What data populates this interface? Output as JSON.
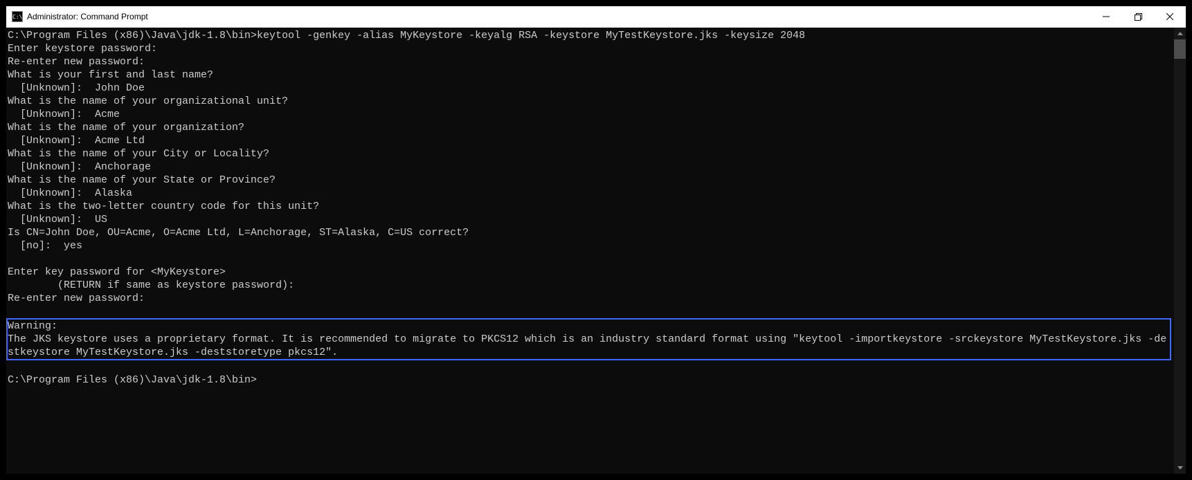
{
  "window": {
    "title": "Administrator: Command Prompt",
    "icon_label": "C:\\"
  },
  "terminal": {
    "lines": [
      "C:\\Program Files (x86)\\Java\\jdk-1.8\\bin>keytool -genkey -alias MyKeystore -keyalg RSA -keystore MyTestKeystore.jks -keysize 2048",
      "Enter keystore password:",
      "Re-enter new password:",
      "What is your first and last name?",
      "  [Unknown]:  John Doe",
      "What is the name of your organizational unit?",
      "  [Unknown]:  Acme",
      "What is the name of your organization?",
      "  [Unknown]:  Acme Ltd",
      "What is the name of your City or Locality?",
      "  [Unknown]:  Anchorage",
      "What is the name of your State or Province?",
      "  [Unknown]:  Alaska",
      "What is the two-letter country code for this unit?",
      "  [Unknown]:  US",
      "Is CN=John Doe, OU=Acme, O=Acme Ltd, L=Anchorage, ST=Alaska, C=US correct?",
      "  [no]:  yes",
      "",
      "Enter key password for <MyKeystore>",
      "        (RETURN if same as keystore password):",
      "Re-enter new password:",
      ""
    ],
    "warning_block": "Warning:\nThe JKS keystore uses a proprietary format. It is recommended to migrate to PKCS12 which is an industry standard format using \"keytool -importkeystore -srckeystore MyTestKeystore.jks -destkeystore MyTestKeystore.jks -deststoretype pkcs12\".",
    "trailing_lines": [
      "",
      "C:\\Program Files (x86)\\Java\\jdk-1.8\\bin>"
    ]
  }
}
